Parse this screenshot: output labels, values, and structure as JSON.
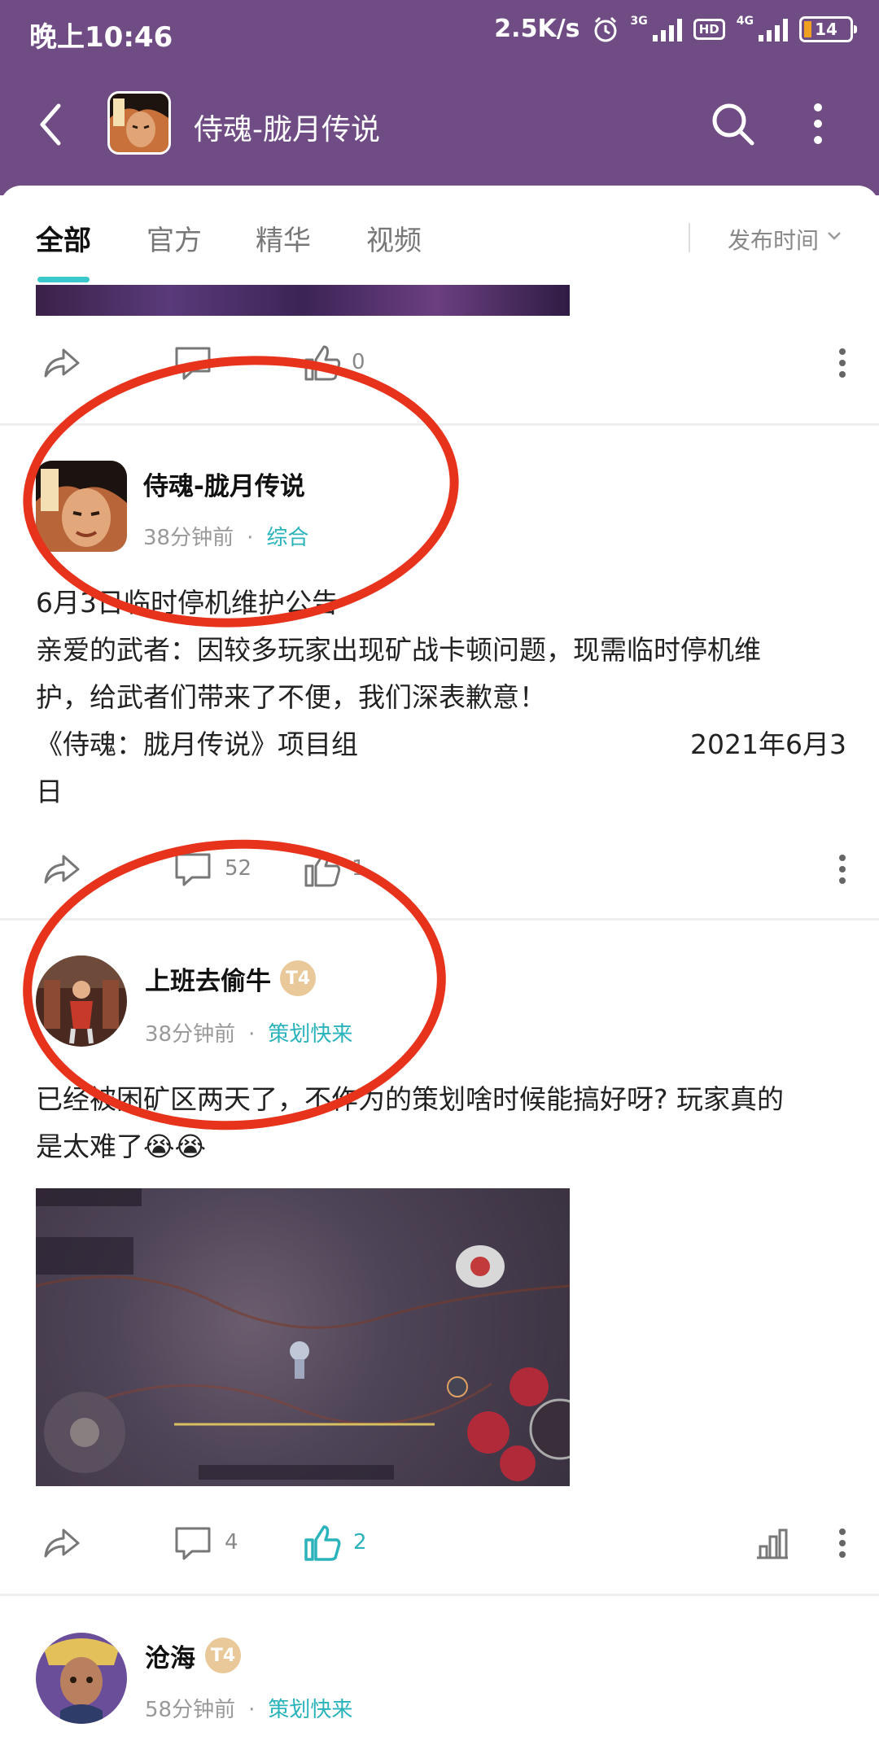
{
  "status_bar": {
    "time": "晚上10:46",
    "net_speed": "2.5K/s",
    "sig1_label": "3G",
    "sig2_label": "4G",
    "hd_label": "HD",
    "battery": "14"
  },
  "header": {
    "title": "侍魂-胧月传说",
    "icons": [
      "back-icon",
      "app-icon",
      "search-icon",
      "more-icon"
    ]
  },
  "tabs": {
    "items": [
      {
        "label": "全部",
        "active": true
      },
      {
        "label": "官方",
        "active": false
      },
      {
        "label": "精华",
        "active": false
      },
      {
        "label": "视频",
        "active": false
      }
    ],
    "sort_label": "发布时间"
  },
  "posts": [
    {
      "counts": {
        "comments": "",
        "likes": "0"
      }
    },
    {
      "author": "侍魂-胧月传说",
      "time": "38分钟前",
      "separator": "·",
      "category": "综合",
      "lines": [
        "6月3日临时停机维护公告",
        "亲爱的武者：因较多玩家出现矿战卡顿问题，现需临时停机维",
        "护，给武者们带来了不便，我们深表歉意！"
      ],
      "sign_left": "《侍魂：胧月传说》项目组",
      "sign_right": "2021年6月3",
      "sign_end": "日",
      "counts": {
        "comments": "52",
        "likes": "1"
      }
    },
    {
      "author": "上班去偷牛",
      "badge": "T4",
      "time": "38分钟前",
      "separator": "·",
      "category": "策划快来",
      "line1": "已经被困矿区两天了，不作为的策划啥时候能搞好呀? 玩家真的",
      "line2": "是太难了😭😭",
      "counts": {
        "comments": "4",
        "likes": "2"
      }
    },
    {
      "author": "沧海",
      "badge": "T4",
      "time": "58分钟前",
      "separator": "·",
      "category": "策划快来"
    }
  ],
  "colors": {
    "header_bg": "#704c84",
    "accent": "#3ac8cc",
    "annotation_red": "#e8331c"
  }
}
